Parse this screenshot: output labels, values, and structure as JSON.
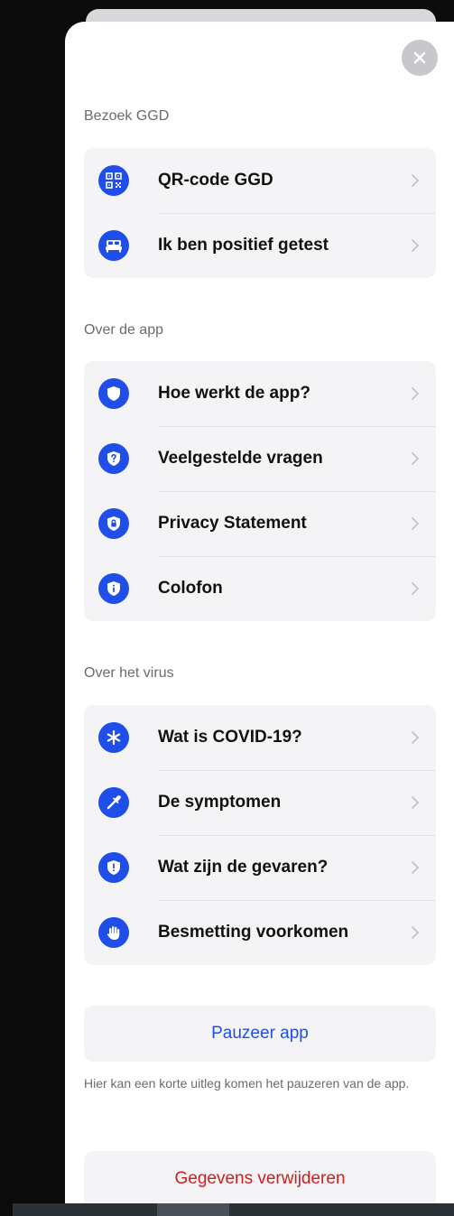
{
  "sections": {
    "visit": {
      "title": "Bezoek GGD",
      "items": [
        {
          "label": "QR-code GGD",
          "icon": "qr-code-icon"
        },
        {
          "label": "Ik ben positief getest",
          "icon": "bed-icon"
        }
      ]
    },
    "about_app": {
      "title": "Over de app",
      "items": [
        {
          "label": "Hoe werkt de app?",
          "icon": "shield-icon"
        },
        {
          "label": "Veelgestelde vragen",
          "icon": "question-shield-icon"
        },
        {
          "label": "Privacy Statement",
          "icon": "lock-shield-icon"
        },
        {
          "label": "Colofon",
          "icon": "info-shield-icon"
        }
      ]
    },
    "about_virus": {
      "title": "Over het virus",
      "items": [
        {
          "label": "Wat is COVID-19?",
          "icon": "asterisk-icon"
        },
        {
          "label": "De symptomen",
          "icon": "pipette-icon"
        },
        {
          "label": "Wat zijn de gevaren?",
          "icon": "alert-shield-icon"
        },
        {
          "label": "Besmetting voorkomen",
          "icon": "hand-icon"
        }
      ]
    }
  },
  "actions": {
    "pause_label": "Pauzeer app",
    "pause_explanation": "Hier kan een korte uitleg komen het pauzeren van de app.",
    "delete_label": "Gegevens verwijderen"
  },
  "colors": {
    "accent": "#1f4ee8",
    "danger": "#d01d1d",
    "group_bg": "#f4f4f6",
    "label_gray": "#6b6b70"
  }
}
